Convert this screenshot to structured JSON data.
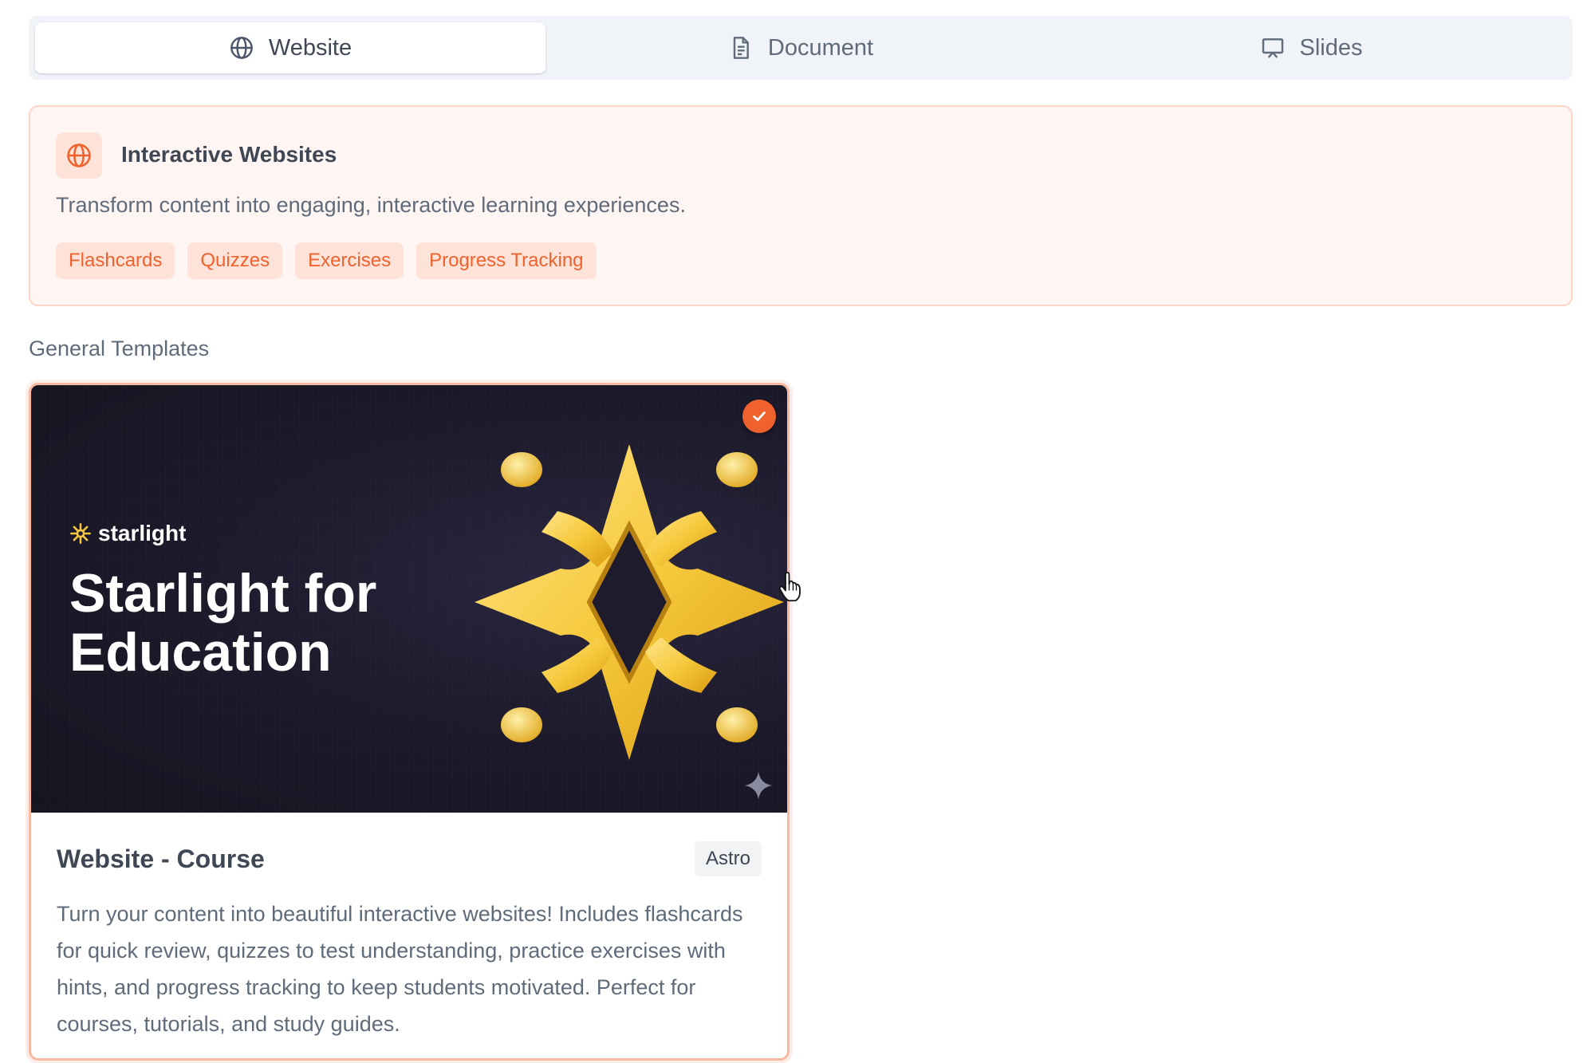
{
  "tabs": [
    {
      "label": "Website",
      "icon": "globe-icon",
      "active": true
    },
    {
      "label": "Document",
      "icon": "document-icon",
      "active": false
    },
    {
      "label": "Slides",
      "icon": "presentation-icon",
      "active": false
    }
  ],
  "info": {
    "icon": "globe-icon",
    "title": "Interactive Websites",
    "description": "Transform content into engaging, interactive learning experiences.",
    "chips": [
      "Flashcards",
      "Quizzes",
      "Exercises",
      "Progress Tracking"
    ]
  },
  "section_label": "General Templates",
  "template_card": {
    "selected": true,
    "thumbnail": {
      "brand": "starlight",
      "title": "Starlight for Education"
    },
    "title": "Website - Course",
    "tag": "Astro",
    "description": "Turn your content into beautiful interactive websites! Includes flashcards for quick review, quizzes to test understanding, practice exercises with hints, and progress tracking to keep students motivated. Perfect for courses, tutorials, and study guides."
  },
  "colors": {
    "accent": "#f0622d",
    "accent_light": "#ffe3d8",
    "info_bg": "#fff6f3",
    "tabs_bg": "#f0f4f8"
  }
}
